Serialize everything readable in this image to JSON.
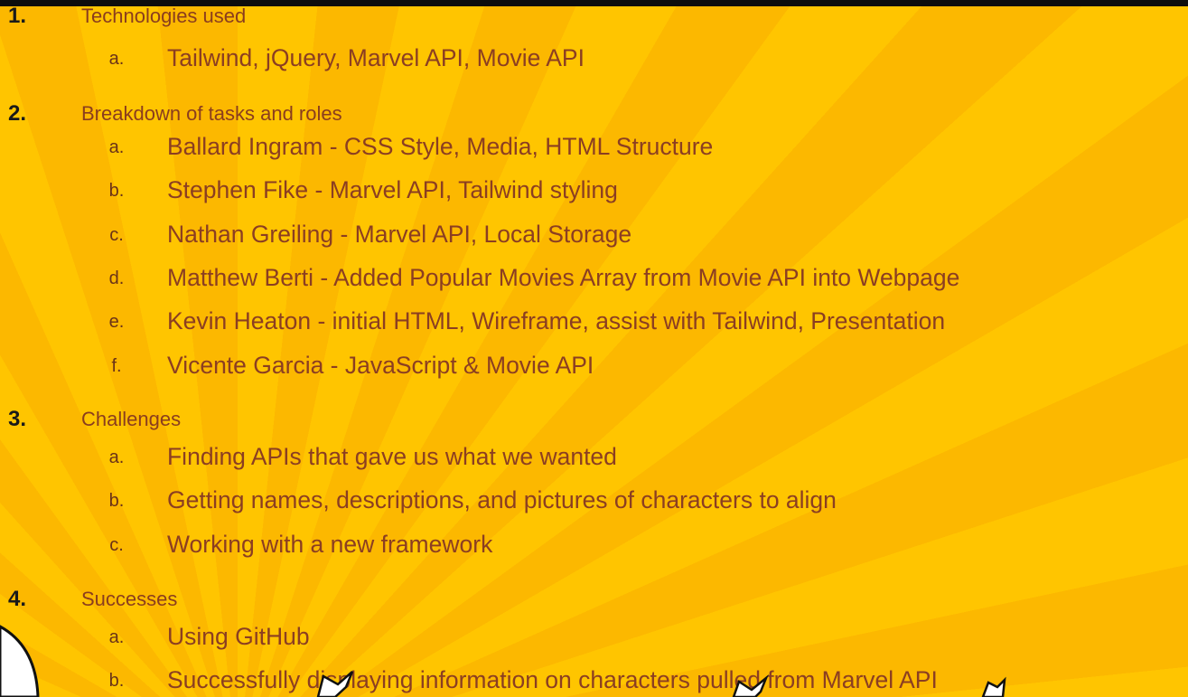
{
  "colors": {
    "background": "#fec200",
    "top_bar": "#0d0d0d",
    "number_text": "#1a1a1a",
    "heading_text": "#8a3d1e",
    "item_text": "#8b3e22"
  },
  "sections": [
    {
      "number": "1.",
      "heading": "Technologies used",
      "items": [
        {
          "letter": "a.",
          "text": "Tailwind, jQuery, Marvel API, Movie API"
        }
      ]
    },
    {
      "number": "2.",
      "heading": "Breakdown of tasks and roles",
      "items": [
        {
          "letter": "a.",
          "text": "Ballard Ingram - CSS Style, Media, HTML Structure"
        },
        {
          "letter": "b.",
          "text": "Stephen Fike - Marvel API, Tailwind styling"
        },
        {
          "letter": "c.",
          "text": "Nathan Greiling - Marvel API, Local Storage"
        },
        {
          "letter": "d.",
          "text": "Matthew Berti - Added Popular Movies Array from Movie API into Webpage"
        },
        {
          "letter": "e.",
          "text": "Kevin Heaton - initial HTML, Wireframe, assist with Tailwind, Presentation"
        },
        {
          "letter": "f.",
          "text": "Vicente Garcia - JavaScript & Movie API"
        }
      ]
    },
    {
      "number": "3.",
      "heading": "Challenges",
      "items": [
        {
          "letter": "a.",
          "text": "Finding APIs that gave us what we wanted"
        },
        {
          "letter": "b.",
          "text": "Getting names, descriptions, and pictures of characters to align"
        },
        {
          "letter": "c.",
          "text": "Working with a new framework"
        }
      ]
    },
    {
      "number": "4.",
      "heading": "Successes",
      "items": [
        {
          "letter": "a.",
          "text": "Using GitHub"
        },
        {
          "letter": "b.",
          "text": "Successfully displaying information on characters pulled from Marvel API"
        }
      ]
    }
  ]
}
